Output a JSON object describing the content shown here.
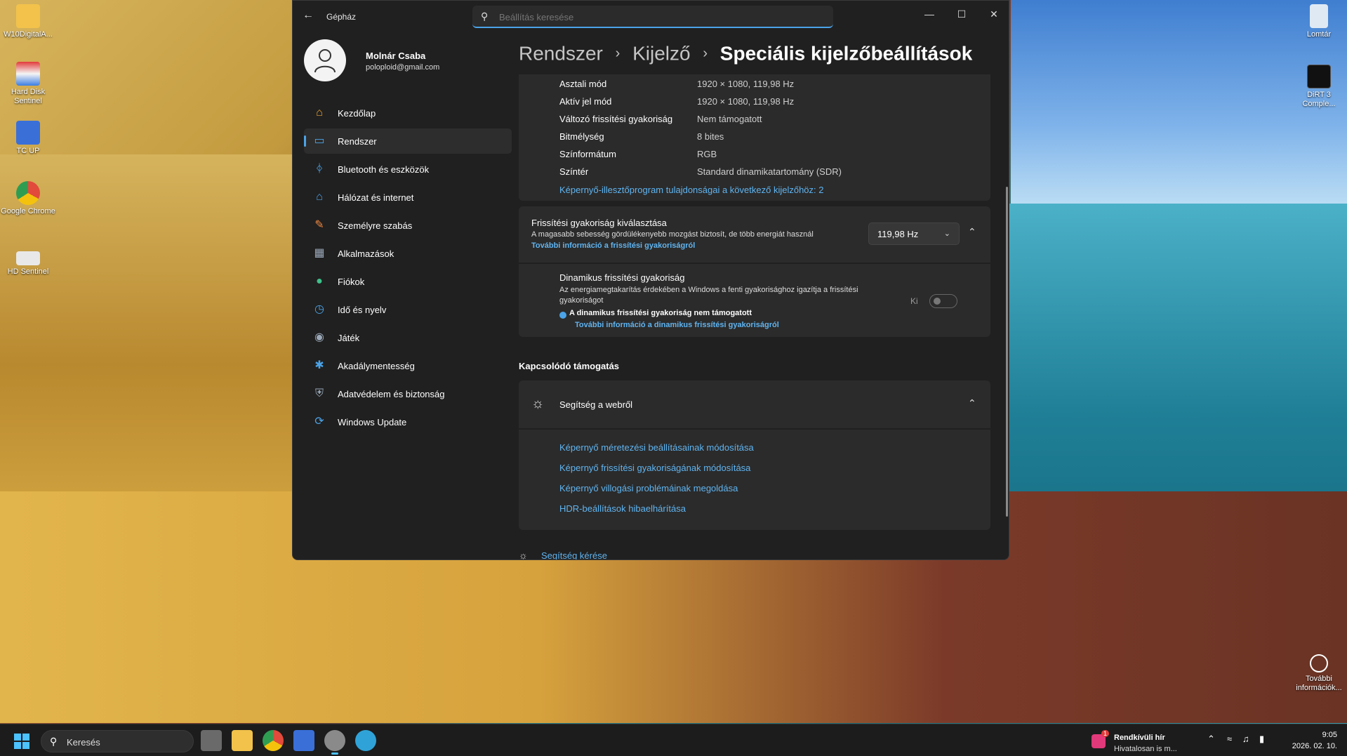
{
  "desktop": {
    "icons": [
      {
        "label": "W10DigitalA..."
      },
      {
        "label": "Hard Disk Sentinel"
      },
      {
        "label": "TC UP"
      },
      {
        "label": "Google Chrome"
      },
      {
        "label": "HD Sentinel"
      },
      {
        "label": "Lomtár"
      },
      {
        "label": "DiRT 3 Comple..."
      },
      {
        "label": "További információk..."
      }
    ]
  },
  "window": {
    "title": "Gépház",
    "search_placeholder": "Beállítás keresése",
    "profile": {
      "name": "Molnár Csaba",
      "email": "poloploid@gmail.com"
    },
    "nav": [
      {
        "label": "Kezdőlap",
        "icon": "home-icon",
        "color": "#f0a830"
      },
      {
        "label": "Rendszer",
        "icon": "monitor-icon",
        "color": "#4ba3e8",
        "active": true
      },
      {
        "label": "Bluetooth és eszközök",
        "icon": "bluetooth-icon",
        "color": "#4ba3e8"
      },
      {
        "label": "Hálózat és internet",
        "icon": "wifi-icon",
        "color": "#4ba3e8"
      },
      {
        "label": "Személyre szabás",
        "icon": "brush-icon",
        "color": "#f08a40"
      },
      {
        "label": "Alkalmazások",
        "icon": "apps-icon",
        "color": "#9aa8b8"
      },
      {
        "label": "Fiókok",
        "icon": "person-icon",
        "color": "#3ec08a"
      },
      {
        "label": "Idő és nyelv",
        "icon": "clock-globe-icon",
        "color": "#4ba3e8"
      },
      {
        "label": "Játék",
        "icon": "gamepad-icon",
        "color": "#9aa8b8"
      },
      {
        "label": "Akadálymentesség",
        "icon": "accessibility-icon",
        "color": "#4ba3e8"
      },
      {
        "label": "Adatvédelem és biztonság",
        "icon": "shield-icon",
        "color": "#9aa8b8"
      },
      {
        "label": "Windows Update",
        "icon": "update-icon",
        "color": "#4ba3e8"
      }
    ],
    "breadcrumb": {
      "level1": "Rendszer",
      "level2": "Kijelző",
      "current": "Speciális kijelzőbeállítások"
    },
    "info_rows": [
      {
        "key": "Asztali mód",
        "value": "1920 × 1080, 119,98 Hz"
      },
      {
        "key": "Aktív jel mód",
        "value": "1920 × 1080, 119,98 Hz"
      },
      {
        "key": "Változó frissítési gyakoriság",
        "value": "Nem támogatott"
      },
      {
        "key": "Bitmélység",
        "value": "8 bites"
      },
      {
        "key": "Színformátum",
        "value": "RGB"
      },
      {
        "key": "Színtér",
        "value": "Standard dinamikatartomány (SDR)"
      }
    ],
    "info_link": "Képernyő-illesztőprogram tulajdonságai a következő kijelzőhöz: 2",
    "refresh": {
      "title": "Frissítési gyakoriság kiválasztása",
      "desc": "A magasabb sebesség gördülékenyebb mozgást biztosít, de több energiát használ",
      "link": "További információ a frissítési gyakoriságról",
      "selected": "119,98 Hz"
    },
    "dynamic": {
      "title": "Dinamikus frissítési gyakoriság",
      "desc": "Az energiamegtakarítás érdekében a Windows a fenti gyakorisághoz igazítja a frissítési gyakoriságot",
      "note": "A dinamikus frissítési gyakoriság nem támogatott",
      "link": "További információ a dinamikus frissítési gyakoriságról",
      "toggle_label": "Ki"
    },
    "related": {
      "heading": "Kapcsolódó támogatás",
      "help_title": "Segítség a webről",
      "links": [
        "Képernyő méretezési beállításainak módosítása",
        "Képernyő frissítési gyakoriságának módosítása",
        "Képernyő villogási problémáinak megoldása",
        "HDR-beállítások hibaelhárítása"
      ],
      "get_help": "Segítség kérése"
    }
  },
  "taskbar": {
    "search_label": "Keresés",
    "news_badge": "1",
    "news_title": "Rendkívüli hír",
    "news_sub": "Hivatalosan is m...",
    "time": "9:05",
    "date": "2026. 02. 10."
  }
}
